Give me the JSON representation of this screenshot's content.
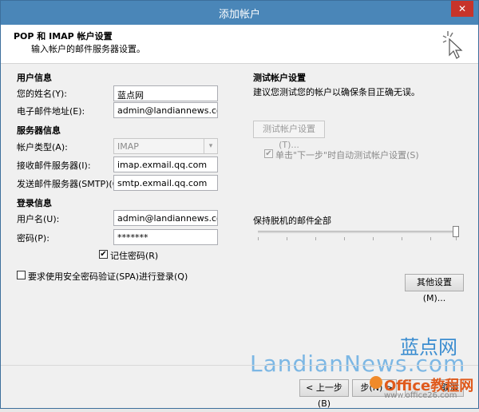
{
  "window": {
    "title": "添加帐户",
    "close_glyph": "✕"
  },
  "header": {
    "title": "POP 和 IMAP 帐户设置",
    "subtitle": "输入帐户的邮件服务器设置。"
  },
  "user_info": {
    "section": "用户信息",
    "name_label": "您的姓名(Y):",
    "name_value": "蓝点网",
    "email_label": "电子邮件地址(E):",
    "email_value": "admin@landiannews.com"
  },
  "server_info": {
    "section": "服务器信息",
    "account_type_label": "帐户类型(A):",
    "account_type_value": "IMAP",
    "incoming_label": "接收邮件服务器(I):",
    "incoming_value": "imap.exmail.qq.com",
    "outgoing_label": "发送邮件服务器(SMTP)(O):",
    "outgoing_value": "smtp.exmail.qq.com"
  },
  "login_info": {
    "section": "登录信息",
    "username_label": "用户名(U):",
    "username_value": "admin@landiannews.com",
    "password_label": "密码(P):",
    "password_value": "*******",
    "remember_label": "记住密码(R)",
    "remember_checked": "✔"
  },
  "spa": {
    "label": "要求使用安全密码验证(SPA)进行登录(Q)"
  },
  "test_settings": {
    "section": "测试帐户设置",
    "description": "建议您测试您的帐户以确保条目正确无误。",
    "test_button": "测试帐户设置(T)...",
    "auto_test_label": "单击\"下一步\"时自动测试帐户设置(S)",
    "auto_test_checked": "✔"
  },
  "offline": {
    "label": "保持脱机的邮件:",
    "value": "全部",
    "level_fraction": 1.0
  },
  "more_settings_button": "其他设置(M)...",
  "footer": {
    "back_button": "< 上一步(B)",
    "next_button_partial": "步(N) >",
    "cancel_partial": "取消"
  },
  "watermarks": {
    "site_cn": "蓝点网",
    "site_en": "LandianNews.com",
    "office_brand": "Office教程网",
    "office_url": "www.office26.com"
  },
  "icons": {
    "header_icon": "cursor-sparkle-icon",
    "select_arrow": "chevron-down-icon",
    "office_logo": "office-logo-icon"
  }
}
